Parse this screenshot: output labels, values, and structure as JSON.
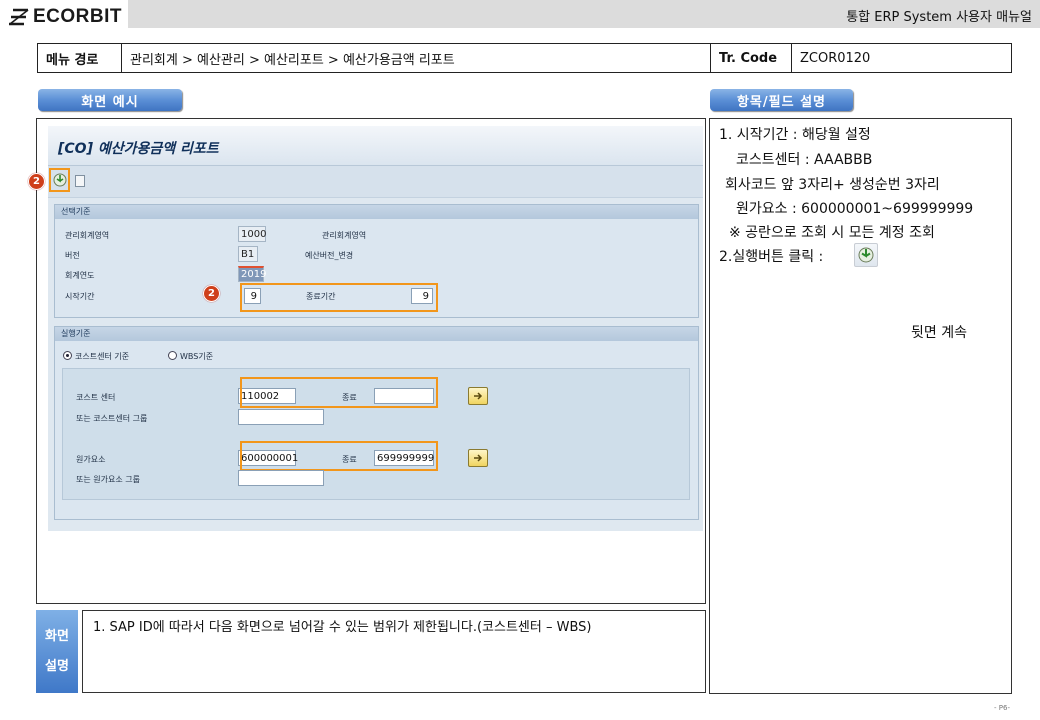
{
  "header": {
    "logo_text": "ECORBIT",
    "title": "통합 ERP System 사용자 매뉴얼"
  },
  "path": {
    "label": "메뉴 경로",
    "value": "관리회계 > 예산관리 > 예산리포트 > 예산가용금액 리포트",
    "tcode_label": "Tr. Code",
    "tcode_value": "ZCOR0120"
  },
  "sections": {
    "screen_example": "화면 예시",
    "field_desc": "항목/필드 설명"
  },
  "sap": {
    "title": "[CO] 예산가용금액 리포트",
    "badge_label": "2",
    "selection": {
      "header": "선택기준",
      "rows": [
        {
          "label": "관리회계영역",
          "value": "1000",
          "desc": "관리회계영역"
        },
        {
          "label": "버전",
          "value": "B1",
          "desc": "예산버전_변경"
        },
        {
          "label": "회계연도",
          "value": "2019"
        }
      ],
      "period_label": "시작기간",
      "period_start": "9",
      "period_end_label": "종료기간",
      "period_end": "9"
    },
    "execution": {
      "header": "실행기준",
      "radio_cost": "코스트센터 기준",
      "radio_wbs": "WBS기준",
      "cost_center_label": "코스트 센터",
      "cost_center_value": "110002",
      "to_label_1": "종료",
      "cost_center_group_label": "또는 코스트센터 그룹",
      "cost_element_label": "원가요소",
      "cost_element_value": "600000001",
      "to_label_2": "종료",
      "cost_element_to": "699999999",
      "cost_element_group_label": "또는 원가요소 그룹"
    }
  },
  "description": {
    "side_label_1": "화면",
    "side_label_2": "설명",
    "text": "1.   SAP ID에 따라서 다음 화면으로 넘어갈 수 있는 범위가 제한됩니다.(코스트센터 – WBS)"
  },
  "fields": {
    "lines": [
      "1. 시작기간 : 해당월 설정",
      "   코스트센터 : AAABBB",
      " 회사코드 앞 3자리+ 생성순번 3자리",
      "   원가요소 : 600000001~699999999",
      "  ※ 공란으로 조회 시 모든 계정 조회",
      "2.실행버튼 클릭 :"
    ],
    "continued": "뒷면 계속"
  },
  "footer": {
    "page": "- P6-"
  },
  "colors": {
    "tab_blue": "#3f74c2",
    "highlight_orange": "#f2961b",
    "badge_red": "#cf3f1a"
  }
}
